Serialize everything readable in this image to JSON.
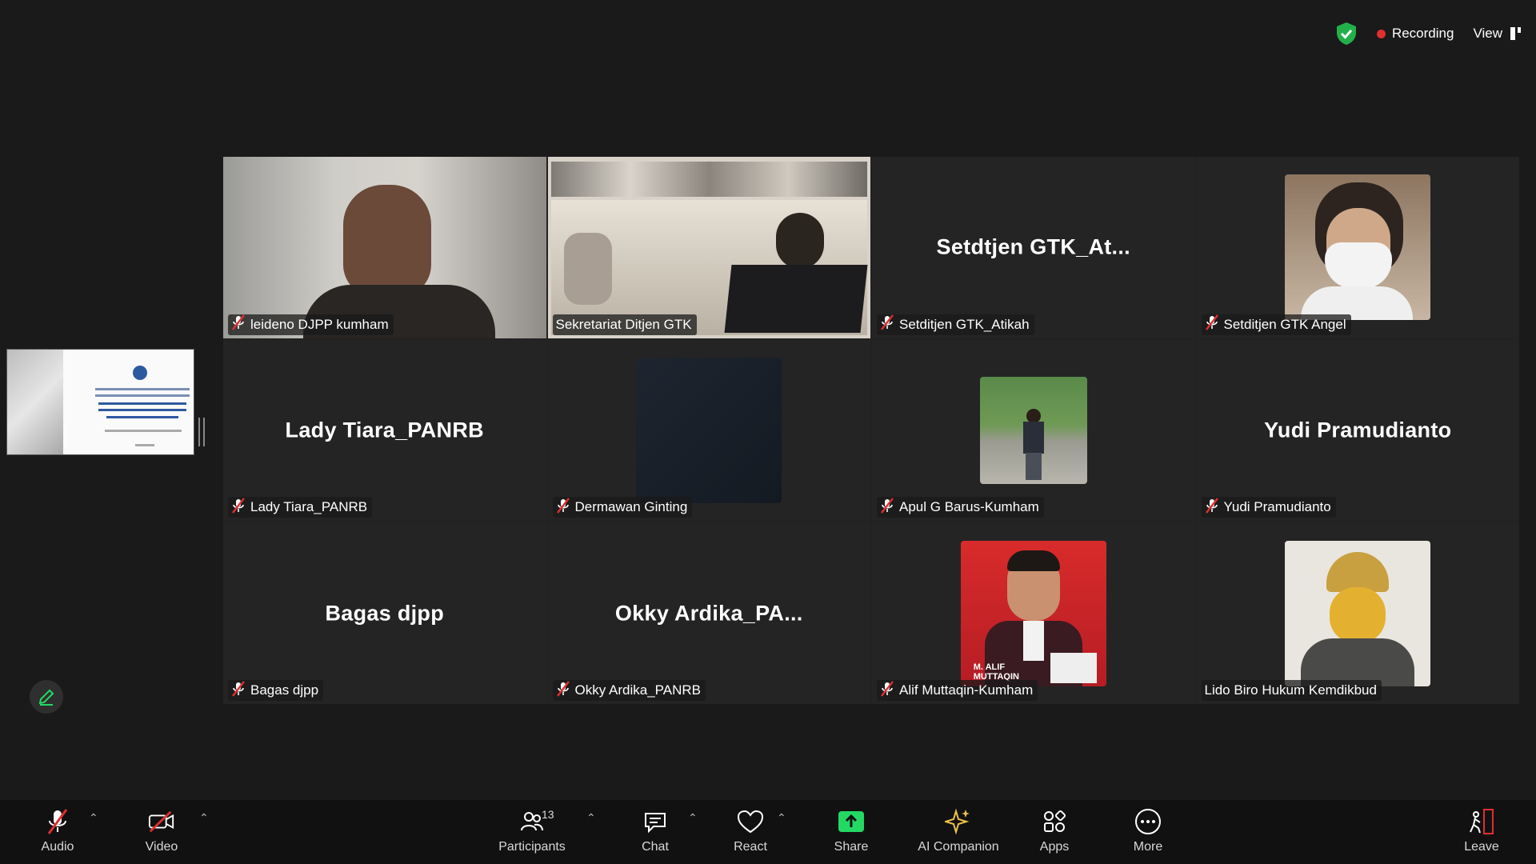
{
  "top": {
    "recording_label": "Recording",
    "view_label": "View"
  },
  "tiles": [
    {
      "big": "",
      "name": "leideno DJPP kumham",
      "muted": true,
      "kind": "video-man"
    },
    {
      "big": "",
      "name": "Sekretariat Ditjen GTK",
      "muted": false,
      "kind": "video-room",
      "active": true
    },
    {
      "big": "Setdtjen  GTK_At...",
      "name": "Setditjen GTK_Atikah",
      "muted": true,
      "kind": "text"
    },
    {
      "big": "",
      "name": "Setditjen GTK Angel",
      "muted": true,
      "kind": "photo-mask"
    },
    {
      "big": "Lady Tiara_PANRB",
      "name": "Lady Tiara_PANRB",
      "muted": true,
      "kind": "text"
    },
    {
      "big": "",
      "name": "Dermawan Ginting",
      "muted": true,
      "kind": "photo-dark"
    },
    {
      "big": "",
      "name": "Apul G Barus-Kumham",
      "muted": true,
      "kind": "photo-park"
    },
    {
      "big": "Yudi Pramudianto",
      "name": "Yudi Pramudianto",
      "muted": true,
      "kind": "text"
    },
    {
      "big": "Bagas djpp",
      "name": "Bagas djpp",
      "muted": true,
      "kind": "text"
    },
    {
      "big": "Okky  Ardika_PA...",
      "name": "Okky Ardika_PANRB",
      "muted": true,
      "kind": "text"
    },
    {
      "big": "",
      "name": "Alif Muttaqin-Kumham",
      "muted": true,
      "kind": "photo-red",
      "badge": "M. ALIF MUTTAQIN"
    },
    {
      "big": "",
      "name": "Lido Biro Hukum Kemdikbud",
      "muted": false,
      "kind": "photo-sketch"
    }
  ],
  "toolbar": {
    "audio": "Audio",
    "video": "Video",
    "participants": "Participants",
    "participants_count": "13",
    "chat": "Chat",
    "react": "React",
    "share": "Share",
    "ai": "AI Companion",
    "apps": "Apps",
    "more": "More",
    "leave": "Leave"
  },
  "colors": {
    "active_border": "#23d962",
    "share_green": "#23d962",
    "mute_red": "#e02f2f"
  }
}
